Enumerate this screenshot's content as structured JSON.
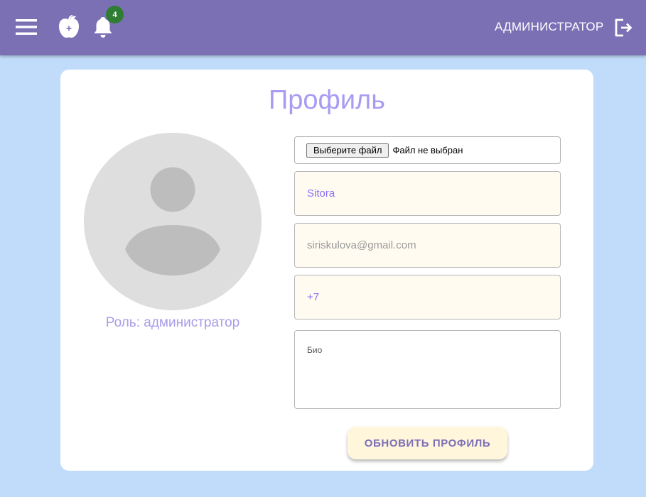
{
  "header": {
    "icons": [
      "menu-icon",
      "apple-icon",
      "bell-icon",
      "logout-icon"
    ],
    "notification_count": "4",
    "user_role": "АДМИНИСТРАТОР"
  },
  "profile": {
    "title": "Профиль",
    "role_caption": "Роль: администратор",
    "file_button_label": "Выберите файл",
    "file_status": "Файл не выбран",
    "name_value": "Sitora",
    "email_value": "siriskulova@gmail.com",
    "phone_value": "+7",
    "bio_placeholder": "Био",
    "update_button_label": "ОБНОВИТЬ ПРОФИЛЬ"
  },
  "colors": {
    "header_bg": "#7c70b5",
    "page_bg": "#c1dcfb",
    "accent": "#a79cf2",
    "badge": "#2e7d32"
  }
}
